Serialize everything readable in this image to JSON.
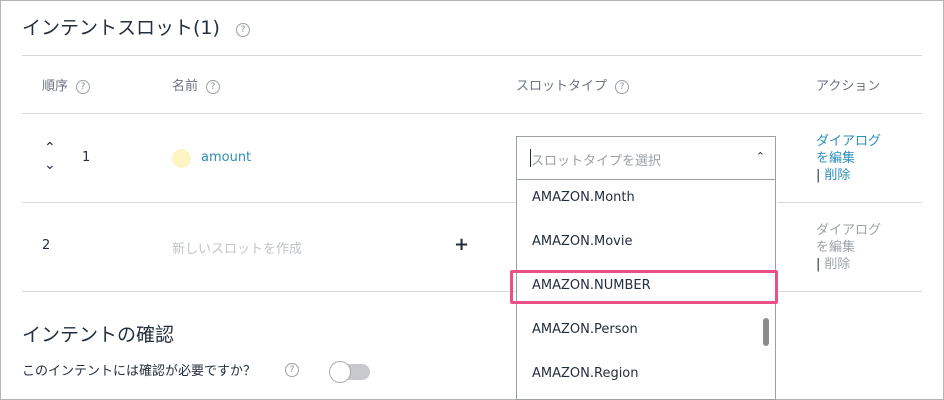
{
  "header": {
    "title": "インテントスロット(1)",
    "help_glyph": "?"
  },
  "table": {
    "columns": {
      "order": "順序",
      "name": "名前",
      "slot_type": "スロットタイプ",
      "action": "アクション"
    },
    "rows": [
      {
        "number": "1",
        "name": "amount",
        "slot_type_placeholder": "スロットタイプを選択",
        "actions": {
          "edit": "ダイアログ を編集",
          "separator": "|",
          "delete": "削除"
        }
      },
      {
        "number": "2",
        "name_placeholder": "新しいスロットを作成",
        "add": "+",
        "actions": {
          "edit": "ダイアログ を編集",
          "separator": "|",
          "delete": "削除"
        }
      }
    ]
  },
  "dropdown": {
    "options": [
      "AMAZON.Month",
      "AMAZON.Movie",
      "AMAZON.NUMBER",
      "AMAZON.Person",
      "AMAZON.Region"
    ],
    "highlighted": "AMAZON.NUMBER"
  },
  "confirm_section": {
    "title": "インテントの確認",
    "question": "このインテントには確認が必要ですか？",
    "toggle_on": false
  },
  "colors": {
    "link": "#2c8fb8",
    "highlight_border": "#ea4f86",
    "slot_dot": "#fdf6c4"
  }
}
